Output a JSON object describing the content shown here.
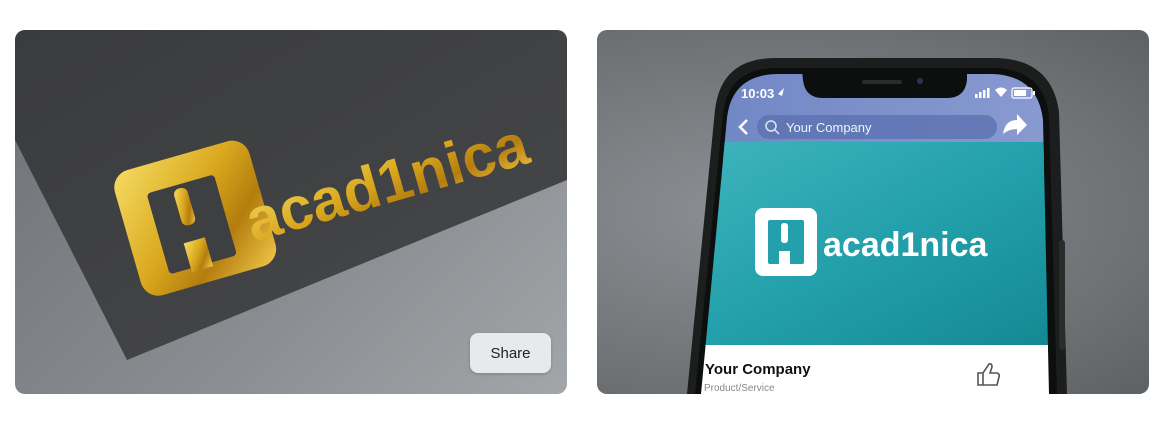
{
  "gallery": {
    "left_card": {
      "brand_text": "acad1nica",
      "share_label": "Share"
    },
    "right_card": {
      "status_time": "10:03",
      "search_text": "Your Company",
      "brand_text": "acad1nica",
      "page_name": "Your Company",
      "page_category": "Product/Service"
    }
  },
  "colors": {
    "gold": "#d9a81e",
    "teal": "#1f9aa6",
    "fb_bar": "#7a8fc9",
    "paper": "#3f4042"
  }
}
